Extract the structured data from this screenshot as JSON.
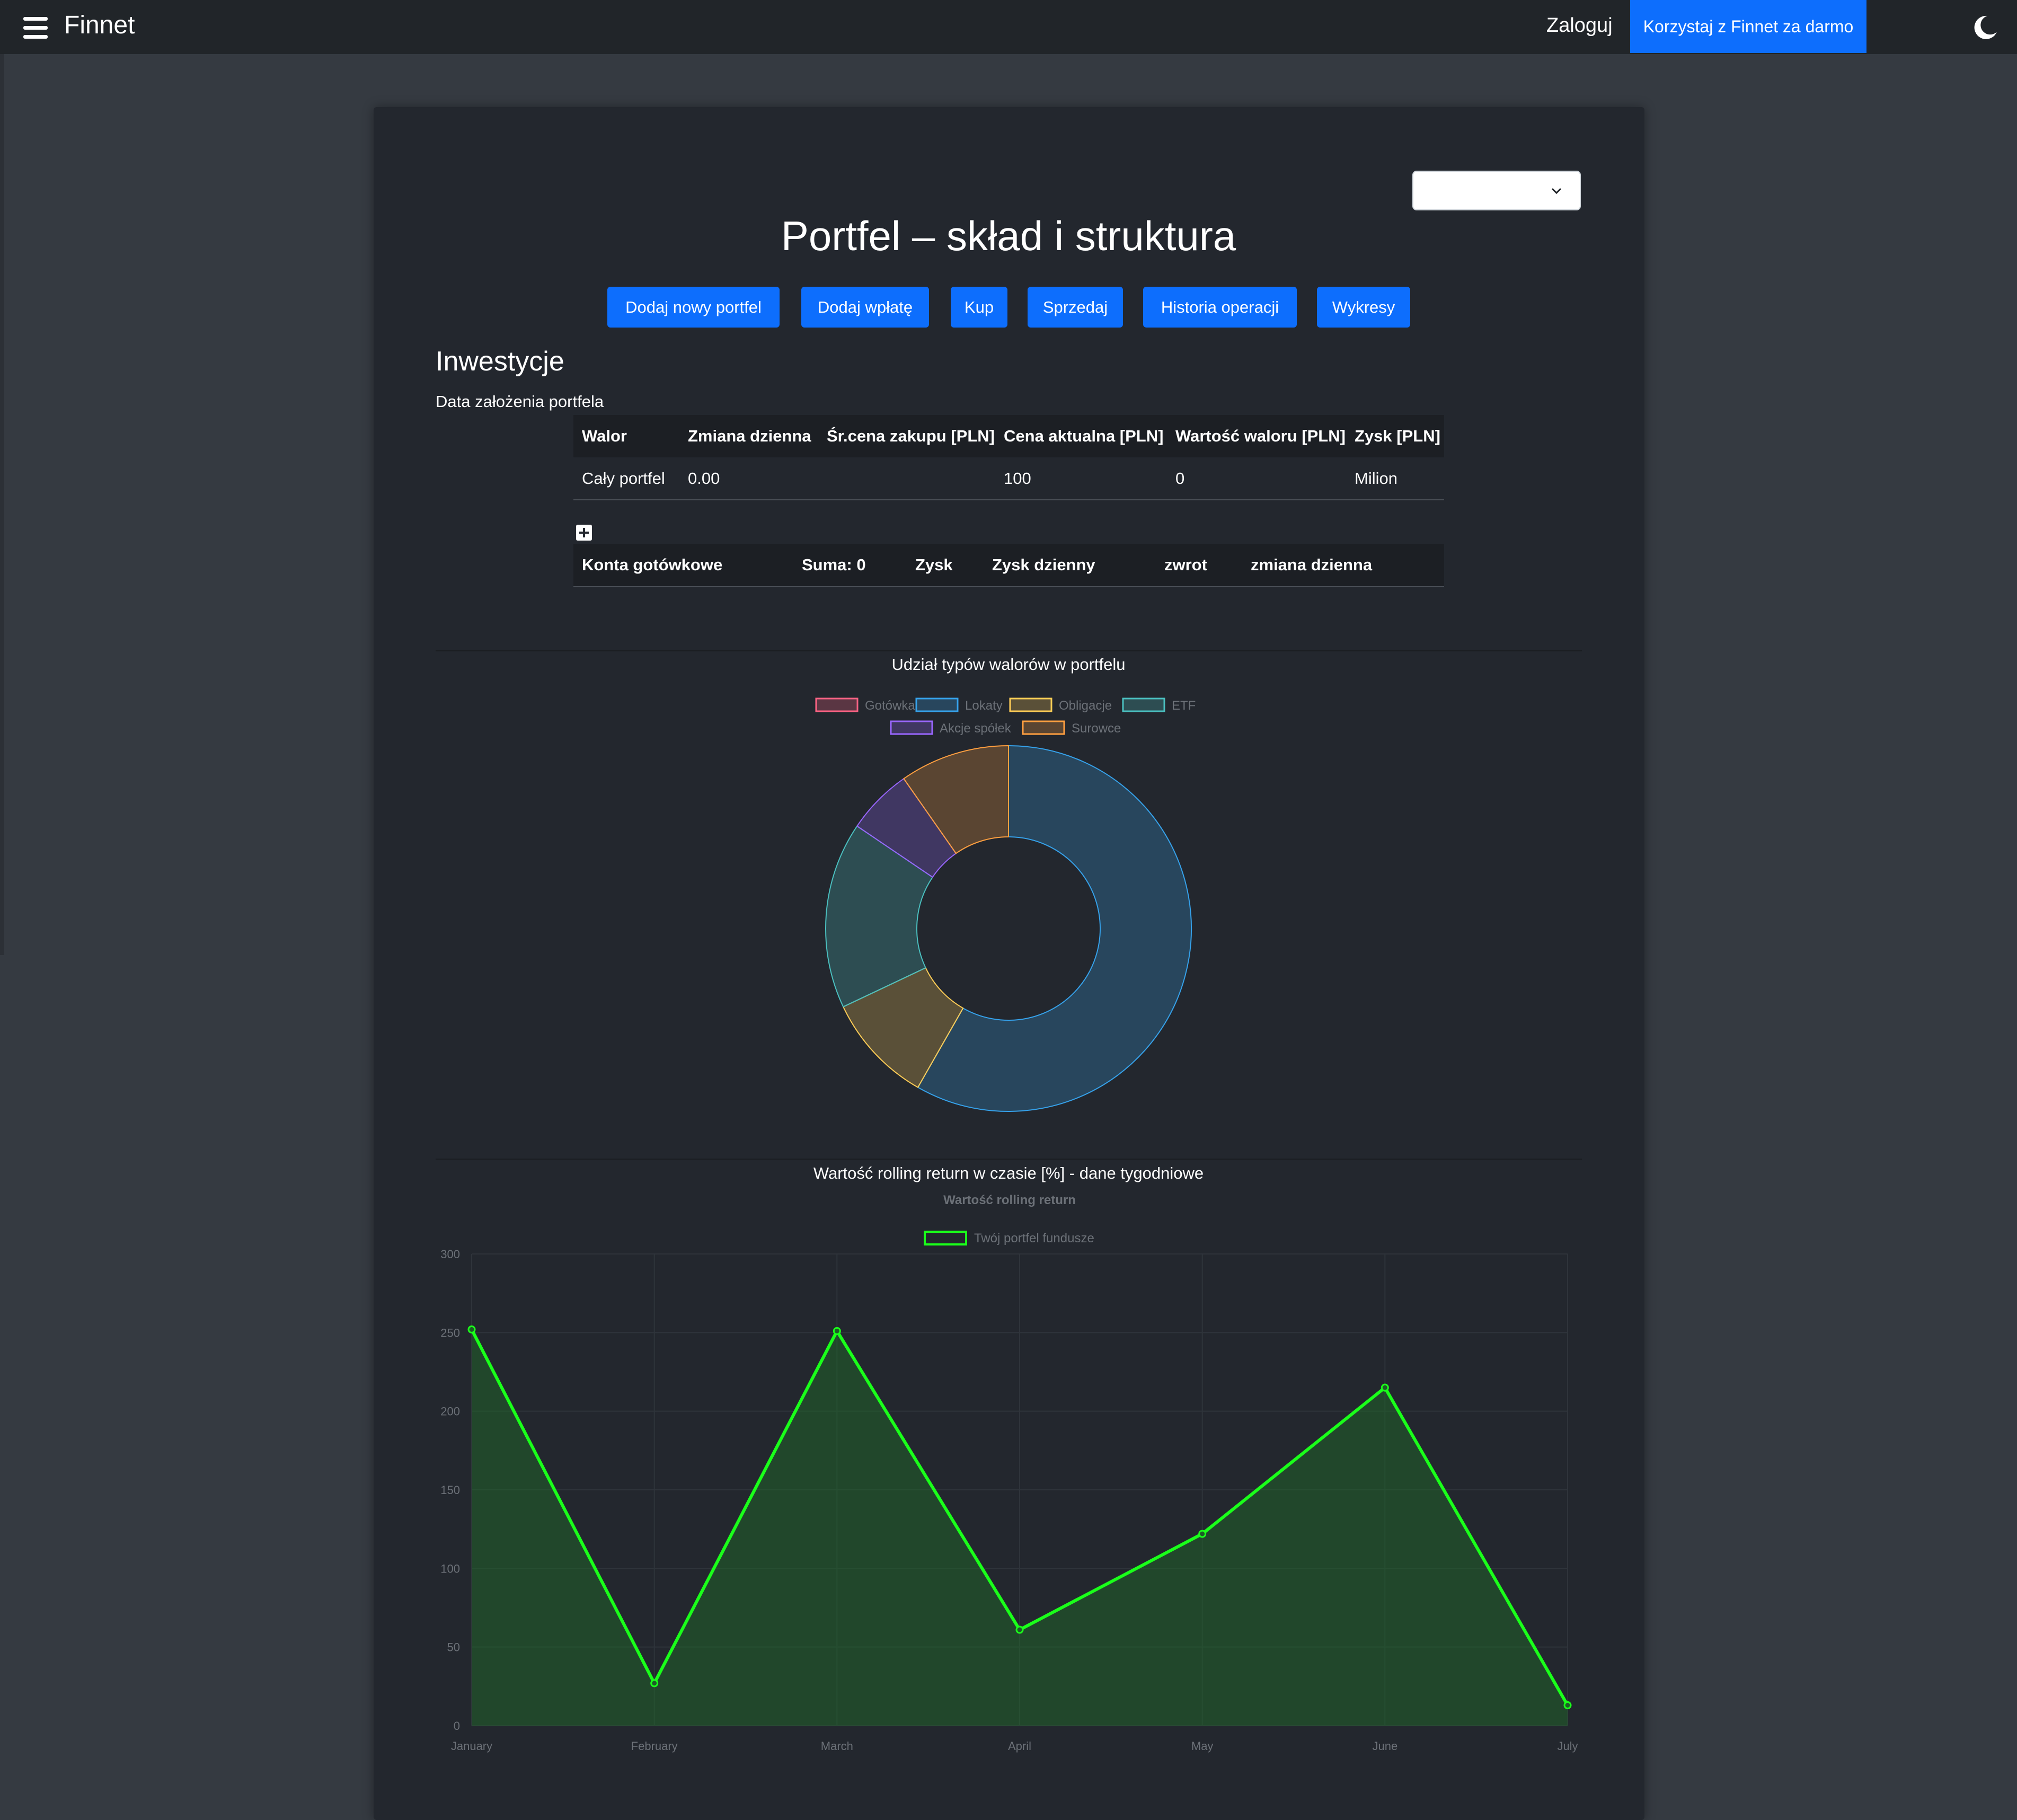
{
  "nav": {
    "brand": "Finnet",
    "login": "Zaloguj",
    "cta": "Korzystaj z Finnet za darmo"
  },
  "page": {
    "title": "Portfel – skład i struktura",
    "select_value": ""
  },
  "actions": [
    {
      "label": "Dodaj nowy portfel"
    },
    {
      "label": "Dodaj wpłatę"
    },
    {
      "label": "Kup"
    },
    {
      "label": "Sprzedaj"
    },
    {
      "label": "Historia operacji"
    },
    {
      "label": "Wykresy"
    }
  ],
  "investments": {
    "heading": "Inwestycje",
    "date_label": "Data założenia portfela",
    "columns": [
      "Walor",
      "Zmiana dzienna",
      "Śr.cena zakupu [PLN]",
      "Cena aktualna [PLN]",
      "Wartość waloru [PLN]",
      "Zysk [PLN]"
    ],
    "rows": [
      [
        "Cały portfel",
        "0.00",
        "",
        "100",
        "0",
        "Milion"
      ]
    ]
  },
  "cash": {
    "label": "Konta gotówkowe",
    "sum": "Suma: 0",
    "profit": "Zysk",
    "daily_profit": "Zysk dzienny",
    "return": "zwrot",
    "daily_change": "zmiana dzienna"
  },
  "colors": {
    "accent": "#0d6efd",
    "navbar": "#212529",
    "card": "#23272e",
    "line": "#1aff1a"
  },
  "chart_data": [
    {
      "type": "pie",
      "title": "Udział typów walorów w portfelu",
      "labels": [
        "Gotówka",
        "Lokaty",
        "Obligacje",
        "ETF",
        "Akcje spółek",
        "Surowce"
      ],
      "values": [
        0,
        60,
        10,
        17,
        6,
        10
      ],
      "colors": [
        "#ff6384",
        "#36a2eb",
        "#ffcd56",
        "#4bc0c0",
        "#9966ff",
        "#ff9f40"
      ],
      "legend": "top"
    },
    {
      "type": "area",
      "title": "Wartość rolling return w czasie [%] - dane tygodniowe",
      "subtitle": "Wartość rolling return",
      "categories": [
        "January",
        "February",
        "March",
        "April",
        "May",
        "June",
        "July"
      ],
      "series": [
        {
          "name": "Twój portfel fundusze",
          "values": [
            252,
            27,
            251,
            61,
            122,
            215,
            13
          ]
        }
      ],
      "ylim": [
        0,
        300
      ],
      "yticks": [
        0,
        50,
        100,
        150,
        200,
        250,
        300
      ],
      "grid": true,
      "legend": "top"
    }
  ]
}
